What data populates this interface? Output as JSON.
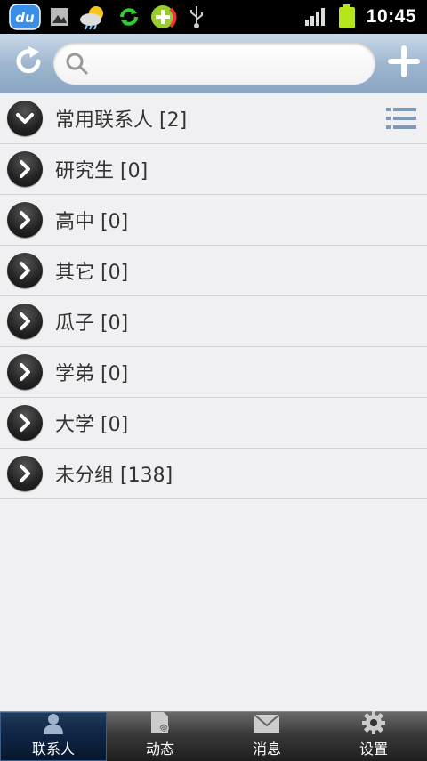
{
  "status_bar": {
    "time": "10:45",
    "icons": [
      "du-app-icon",
      "image-icon",
      "weather-icon",
      "sync-icon",
      "call-app-icon",
      "usb-icon",
      "signal-icon",
      "battery-icon"
    ]
  },
  "toolbar": {
    "search_placeholder": "",
    "search_value": ""
  },
  "groups": [
    {
      "label": "常用联系人 [2]",
      "expanded": true
    },
    {
      "label": "研究生 [0]",
      "expanded": false
    },
    {
      "label": "高中 [0]",
      "expanded": false
    },
    {
      "label": "其它 [0]",
      "expanded": false
    },
    {
      "label": "瓜子 [0]",
      "expanded": false
    },
    {
      "label": "学弟 [0]",
      "expanded": false
    },
    {
      "label": "大学 [0]",
      "expanded": false
    },
    {
      "label": "未分组 [138]",
      "expanded": false
    }
  ],
  "tabs": [
    {
      "label": "联系人",
      "icon": "person-icon",
      "active": true
    },
    {
      "label": "动态",
      "icon": "feed-icon",
      "active": false
    },
    {
      "label": "消息",
      "icon": "envelope-icon",
      "active": false
    },
    {
      "label": "设置",
      "icon": "gear-icon",
      "active": false
    }
  ],
  "colors": {
    "toolbar_accent": "#9fb7cf",
    "active_tab": "#0e2444",
    "battery": "#b5e61d"
  }
}
